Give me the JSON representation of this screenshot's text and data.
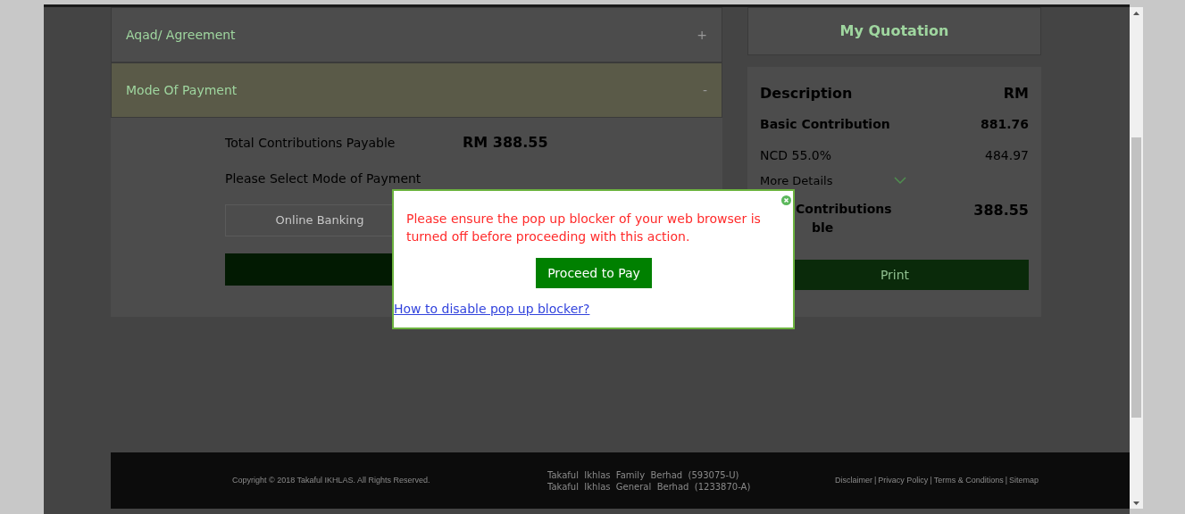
{
  "accordion": [
    {
      "title": "Aqad/ Agreement",
      "expanded": false,
      "toggle": "+"
    },
    {
      "title": "Mode Of Payment",
      "expanded": true,
      "toggle": "-"
    }
  ],
  "payment": {
    "total_label": "Total Contributions Payable",
    "total_value": "RM 388.55",
    "prompt": "Please Select Mode of Payment",
    "options": [
      {
        "label": "Online Banking"
      }
    ]
  },
  "quotation": {
    "title": "My Quotation",
    "header": {
      "label": "Description",
      "value": "RM"
    },
    "rows": [
      {
        "label": "Basic Contribution",
        "value": "881.76",
        "bold": true
      },
      {
        "label": "NCD 55.0%",
        "value": "484.97",
        "bold": false
      }
    ],
    "more_details": "More Details",
    "total": {
      "label_lines": [
        "Contributions",
        "ble"
      ],
      "value": "388.55"
    },
    "print": "Print"
  },
  "modal": {
    "message": "Please ensure the pop up blocker of your web browser is turned off before proceeding with this action.",
    "button": "Proceed to Pay",
    "link": "How to disable pop up blocker?"
  },
  "footer": {
    "copyright": "Copyright © 2018 Takaful IKHLAS. All Rights Reserved.",
    "companies": [
      "Takaful  Ikhlas  Family  Berhad  (593075-U)",
      "Takaful  Ikhlas  General  Berhad  (1233870-A)"
    ],
    "links": [
      "Disclaimer",
      "Privacy Policy",
      "Terms & Conditions",
      "Sitemap"
    ],
    "separator": "|"
  }
}
